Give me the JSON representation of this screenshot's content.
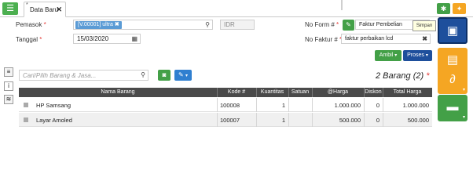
{
  "tabs": [
    {
      "label": "Data Baru",
      "mark": "*"
    }
  ],
  "topbar": {
    "menu_icon": "list-icon",
    "gear_icon": "gear-icon",
    "bulb_icon": "lightbulb-icon"
  },
  "form": {
    "pemasok_label": "Pemasok",
    "pemasok_chip": "[V.00001] ultra",
    "currency": "IDR",
    "tanggal_label": "Tanggal",
    "tanggal_value": "15/03/2020",
    "no_form_label": "No Form #",
    "no_form_value": "Faktur Pembelian",
    "no_faktur_label": "No Faktur #",
    "no_faktur_value": "faktur perbaikan lcd",
    "required_mark": "*"
  },
  "tooltip": "Simpan",
  "buttons": {
    "ambil": "Ambil",
    "proses": "Proses",
    "caret": "⌄"
  },
  "search": {
    "placeholder": "Cari/Pilih Barang & Jasa..."
  },
  "count_text": "2 Barang (2)",
  "count_mark": "*",
  "table": {
    "headers": [
      "Nama Barang",
      "Kode #",
      "Kuantitas",
      "Satuan",
      "@Harga",
      "Diskon",
      "Total Harga"
    ],
    "rows": [
      {
        "nama": "HP Samsang",
        "kode": "100008",
        "qty": "1",
        "satuan": "",
        "harga": "1.000.000",
        "diskon": "0",
        "total": "1.000.000"
      },
      {
        "nama": "Layar Amoled",
        "kode": "100007",
        "qty": "1",
        "satuan": "",
        "harga": "500.000",
        "diskon": "0",
        "total": "500.000"
      }
    ]
  },
  "side_buttons": [
    "save-icon",
    "print-icon",
    "attachment-icon",
    "briefcase-icon"
  ],
  "colors": {
    "green": "#43a047",
    "blue": "#1e4f9c",
    "orange": "#f5a623",
    "header": "#4a4a4a"
  }
}
